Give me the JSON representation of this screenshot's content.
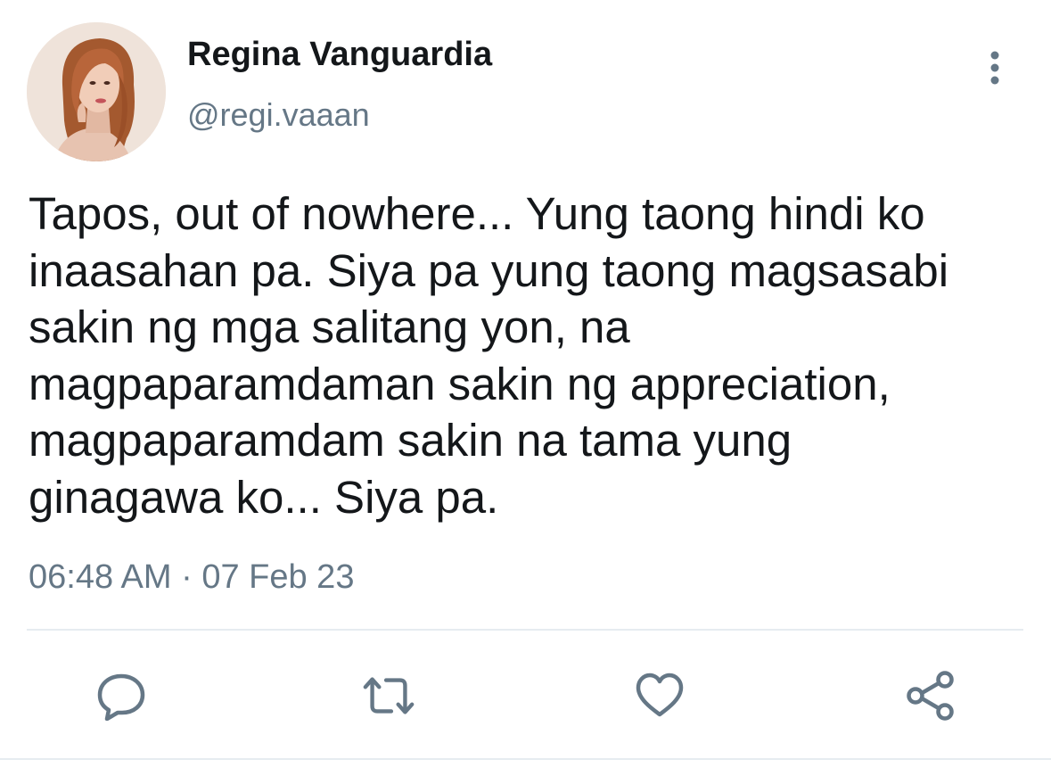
{
  "user": {
    "display_name": "Regina Vanguardia",
    "handle": "@regi.vaaan"
  },
  "tweet": {
    "text": "Tapos, out of nowhere... Yung taong hindi ko\ninaasahan pa. Siya pa yung taong magsasabi\nsakin ng mga salitang yon, na\nmagpaparamdaman sakin ng appreciation,\nmagpaparamdam sakin na tama yung\nginagawa ko... Siya pa.",
    "timestamp": "06:48 AM · 07 Feb 23"
  },
  "icons": {
    "more": "more-vertical-icon",
    "reply": "reply-bubble-icon",
    "retweet": "retweet-icon",
    "like": "heart-icon",
    "share": "share-icon"
  },
  "colors": {
    "text_primary": "#14171a",
    "text_secondary": "#657786",
    "icon": "#657786",
    "divider": "#e6ecf0"
  }
}
